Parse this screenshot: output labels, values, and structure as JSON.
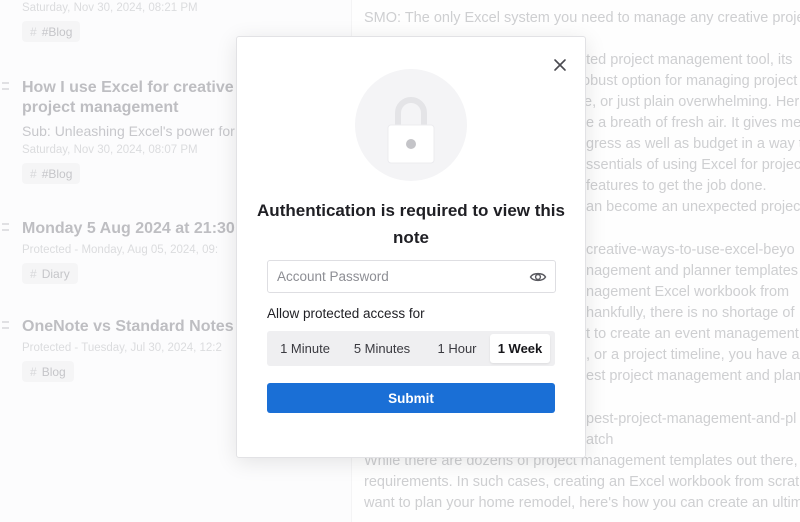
{
  "note_list": {
    "top_date": "Saturday, Nov 30, 2024, 08:21 PM",
    "top_tag": "#Blog",
    "items": [
      {
        "title": "How I use Excel for creative project management",
        "subtitle": "Sub: Unleashing Excel's power for c",
        "date": "Saturday, Nov 30, 2024, 08:07 PM",
        "tag": "#Blog"
      },
      {
        "title": "Monday 5 Aug 2024 at 21:30",
        "date": "Protected - Monday, Aug 05, 2024, 09:",
        "tag": "Diary"
      },
      {
        "title": "OneNote vs Standard Notes",
        "date": "Protected - Tuesday, Jul 30, 2024, 12:2",
        "tag": "Blog"
      }
    ]
  },
  "note_body": {
    "lines": [
      "SMO: The only Excel system you need to manage any creative proje",
      "ated project management tool, its",
      "obust option for managing project",
      "e, or just plain overwhelming. Her",
      "e a breath of fresh air. It gives me",
      "gress as well as budget in a way t",
      "ssentials of using Excel for projec",
      "features to get the job done.",
      "an become an unexpected project",
      "creative-ways-to-use-excel-beyo",
      "nagement and planner templates",
      "nagement Excel workbook from",
      "hankfully, there is no shortage of",
      "t to create an event management",
      ", or a project timeline, you have a",
      "est project management and plann",
      "pest-project-management-and-pl",
      "atch",
      "While there are dozens of project management templates out there,",
      "requirements. In such cases, creating an Excel workbook from scrat",
      "want to plan your home remodel, here's how you can create an ultim"
    ]
  },
  "modal": {
    "title": "Authentication is required to view this note",
    "password_placeholder": "Account Password",
    "password_value": "",
    "allow_label": "Allow protected access for",
    "durations": [
      "1 Minute",
      "5 Minutes",
      "1 Hour",
      "1 Week"
    ],
    "selected_duration": "1 Week",
    "submit_label": "Submit",
    "accent_color": "#1a6fd6"
  }
}
